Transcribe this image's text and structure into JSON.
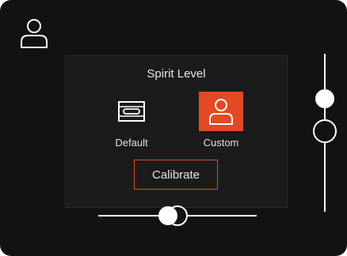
{
  "panel": {
    "title": "Spirit Level",
    "modes": [
      {
        "label": "Default",
        "icon": "level-icon",
        "selected": false
      },
      {
        "label": "Custom",
        "icon": "user-icon",
        "selected": true
      }
    ],
    "calibrate_label": "Calibrate"
  },
  "header": {
    "profile_icon": "user-icon"
  },
  "sliders": {
    "horizontal": {
      "icon": "horizontal-level-slider",
      "position": 0.47
    },
    "vertical": {
      "icon": "vertical-level-slider",
      "position": 0.29
    }
  },
  "colors": {
    "background": "#121212",
    "panel": "#1b1b1b",
    "accent": "#e04a25",
    "text": "#e6e6e6",
    "stroke": "#ffffff"
  }
}
